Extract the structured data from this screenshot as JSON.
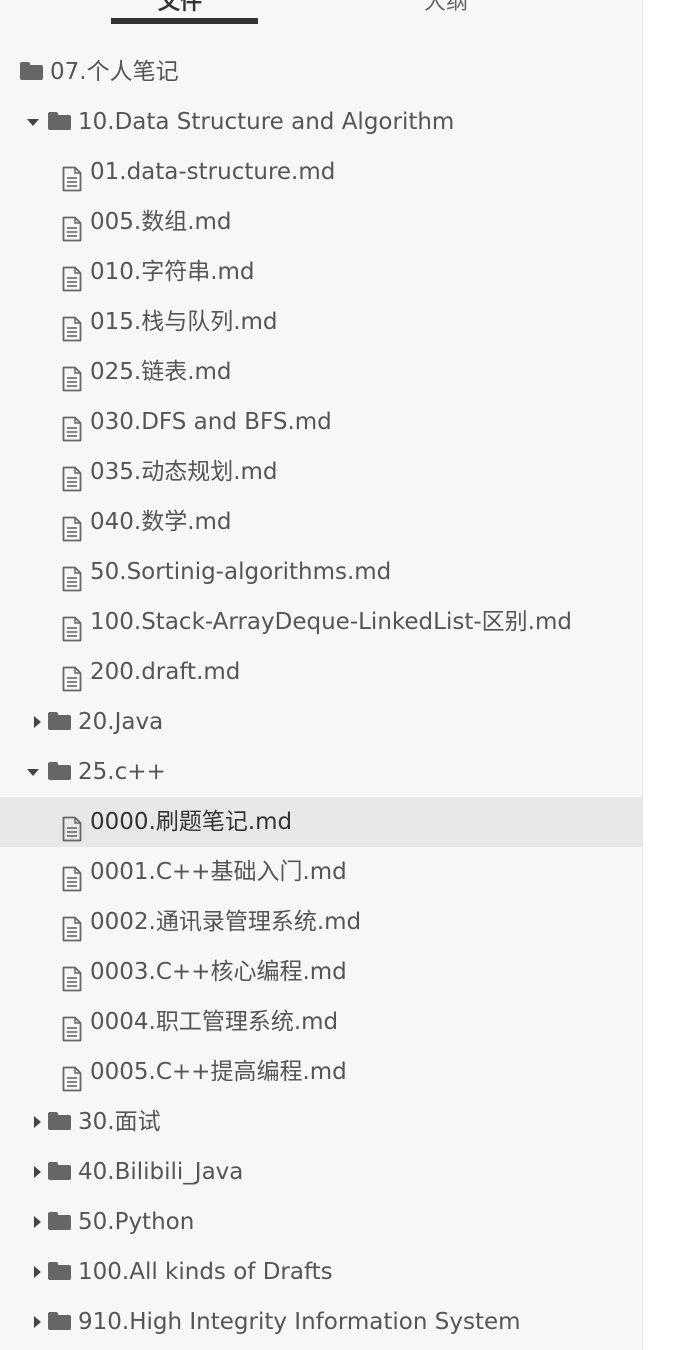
{
  "tabs": {
    "files_label": "文件",
    "outline_label": "大纲"
  },
  "tree": [
    {
      "type": "folder",
      "depth": 0,
      "caret": "none",
      "label": "07.个人笔记",
      "name": "folder-personal-notes"
    },
    {
      "type": "folder",
      "depth": 1,
      "caret": "open",
      "label": "10.Data Structure and Algorithm",
      "name": "folder-data-structure-algorithm"
    },
    {
      "type": "file",
      "depth": 2,
      "label": "01.data-structure.md"
    },
    {
      "type": "file",
      "depth": 2,
      "label": "005.数组.md"
    },
    {
      "type": "file",
      "depth": 2,
      "label": "010.字符串.md"
    },
    {
      "type": "file",
      "depth": 2,
      "label": "015.栈与队列.md"
    },
    {
      "type": "file",
      "depth": 2,
      "label": "025.链表.md"
    },
    {
      "type": "file",
      "depth": 2,
      "label": "030.DFS and BFS.md"
    },
    {
      "type": "file",
      "depth": 2,
      "label": "035.动态规划.md"
    },
    {
      "type": "file",
      "depth": 2,
      "label": "040.数学.md"
    },
    {
      "type": "file",
      "depth": 2,
      "label": "50.Sortinig-algorithms.md"
    },
    {
      "type": "file",
      "depth": 2,
      "label": "100.Stack-ArrayDeque-LinkedList-区别.md"
    },
    {
      "type": "file",
      "depth": 2,
      "label": "200.draft.md"
    },
    {
      "type": "folder",
      "depth": 1,
      "caret": "closed",
      "label": "20.Java",
      "name": "folder-java"
    },
    {
      "type": "folder",
      "depth": 1,
      "caret": "open",
      "label": "25.c++",
      "name": "folder-cpp"
    },
    {
      "type": "file",
      "depth": 2,
      "label": "0000.刷题笔记.md",
      "active": true
    },
    {
      "type": "file",
      "depth": 2,
      "label": "0001.C++基础入门.md"
    },
    {
      "type": "file",
      "depth": 2,
      "label": "0002.通讯录管理系统.md"
    },
    {
      "type": "file",
      "depth": 2,
      "label": "0003.C++核心编程.md"
    },
    {
      "type": "file",
      "depth": 2,
      "label": "0004.职工管理系统.md"
    },
    {
      "type": "file",
      "depth": 2,
      "label": "0005.C++提高编程.md"
    },
    {
      "type": "folder",
      "depth": 1,
      "caret": "closed",
      "label": "30.面试",
      "name": "folder-interview"
    },
    {
      "type": "folder",
      "depth": 1,
      "caret": "closed",
      "label": "40.Bilibili_Java",
      "name": "folder-bilibili-java"
    },
    {
      "type": "folder",
      "depth": 1,
      "caret": "closed",
      "label": "50.Python",
      "name": "folder-python"
    },
    {
      "type": "folder",
      "depth": 1,
      "caret": "closed",
      "label": "100.All kinds of Drafts",
      "name": "folder-drafts"
    },
    {
      "type": "folder",
      "depth": 1,
      "caret": "closed",
      "label": "910.High Integrity Information System",
      "name": "folder-high-integrity"
    }
  ],
  "colors": {
    "sidebar_bg": "#f7f7f7",
    "active_row_bg": "#e8e8e8",
    "icon": "#666666",
    "text": "#555555"
  }
}
